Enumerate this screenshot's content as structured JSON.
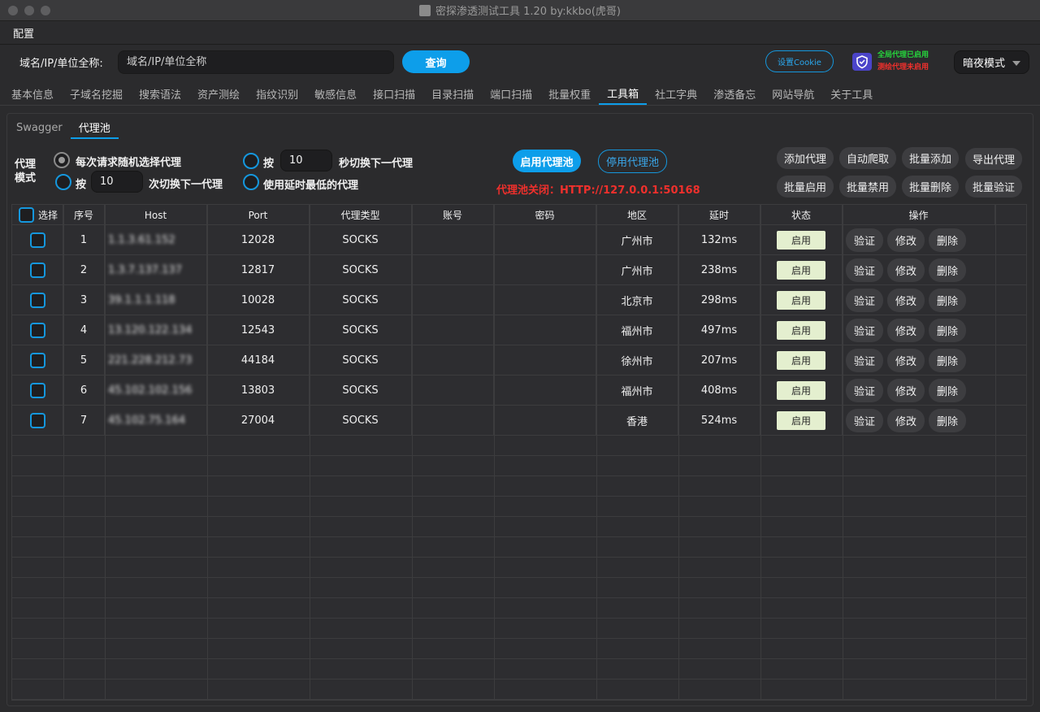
{
  "window": {
    "title": "密探渗透测试工具 1.20 by:kkbo(虎哥)"
  },
  "menu": {
    "config": "配置"
  },
  "query": {
    "label": "域名/IP/单位全称:",
    "placeholder": "域名/IP/单位全称",
    "button": "查询",
    "cookie_button": "设置Cookie",
    "global_proxy": "全局代理已启用",
    "test_proxy": "测绘代理未启用",
    "theme": "暗夜模式"
  },
  "tabs": [
    "基本信息",
    "子域名挖掘",
    "搜索语法",
    "资产测绘",
    "指纹识别",
    "敏感信息",
    "接口扫描",
    "目录扫描",
    "端口扫描",
    "批量权重",
    "工具箱",
    "社工字典",
    "渗透备忘",
    "网站导航",
    "关于工具"
  ],
  "active_tab": "工具箱",
  "subtabs": [
    "Swagger",
    "代理池"
  ],
  "active_subtab": "代理池",
  "proxy_mode": {
    "label_line1": "代理",
    "label_line2": "模式",
    "random": "每次请求随机选择代理",
    "by_count_prefix": "按",
    "by_count_value": "10",
    "by_count_suffix": "次切换下一代理",
    "by_time_prefix": "按",
    "by_time_value": "10",
    "by_time_suffix": "秒切换下一代理",
    "lowest_latency": "使用延时最低的代理"
  },
  "pool": {
    "enable": "启用代理池",
    "disable": "停用代理池",
    "status": "代理池关闭：HTTP://127.0.0.1:50168"
  },
  "actions": {
    "add": "添加代理",
    "auto_crawl": "自动爬取",
    "batch_add": "批量添加",
    "export": "导出代理",
    "batch_enable": "批量启用",
    "batch_disable": "批量禁用",
    "batch_delete": "批量删除",
    "batch_verify": "批量验证"
  },
  "table": {
    "headers": {
      "select": "选择",
      "index": "序号",
      "host": "Host",
      "port": "Port",
      "type": "代理类型",
      "account": "账号",
      "password": "密码",
      "region": "地区",
      "latency": "延时",
      "state": "状态",
      "ops": "操作"
    },
    "rows": [
      {
        "index": "1",
        "host": "1.1.3.61.152",
        "port": "12028",
        "type": "SOCKS",
        "region": "广州市",
        "latency": "132ms",
        "state": "启用"
      },
      {
        "index": "2",
        "host": "1.3.7.137.137",
        "port": "12817",
        "type": "SOCKS",
        "region": "广州市",
        "latency": "238ms",
        "state": "启用"
      },
      {
        "index": "3",
        "host": "39.1.1.1.118",
        "port": "10028",
        "type": "SOCKS",
        "region": "北京市",
        "latency": "298ms",
        "state": "启用"
      },
      {
        "index": "4",
        "host": "13.120.122.134",
        "port": "12543",
        "type": "SOCKS",
        "region": "福州市",
        "latency": "497ms",
        "state": "启用"
      },
      {
        "index": "5",
        "host": "221.228.212.73",
        "port": "44184",
        "type": "SOCKS",
        "region": "徐州市",
        "latency": "207ms",
        "state": "启用"
      },
      {
        "index": "6",
        "host": "45.102.102.156",
        "port": "13803",
        "type": "SOCKS",
        "region": "福州市",
        "latency": "408ms",
        "state": "启用"
      },
      {
        "index": "7",
        "host": "45.102.75.164",
        "port": "27004",
        "type": "SOCKS",
        "region": "香港",
        "latency": "524ms",
        "state": "启用"
      }
    ],
    "row_ops": {
      "verify": "验证",
      "edit": "修改",
      "delete": "删除"
    }
  },
  "colors": {
    "accent": "#0d9eea",
    "danger": "#f0302c",
    "success": "#26d43c",
    "state_bg": "#e4efcf"
  }
}
